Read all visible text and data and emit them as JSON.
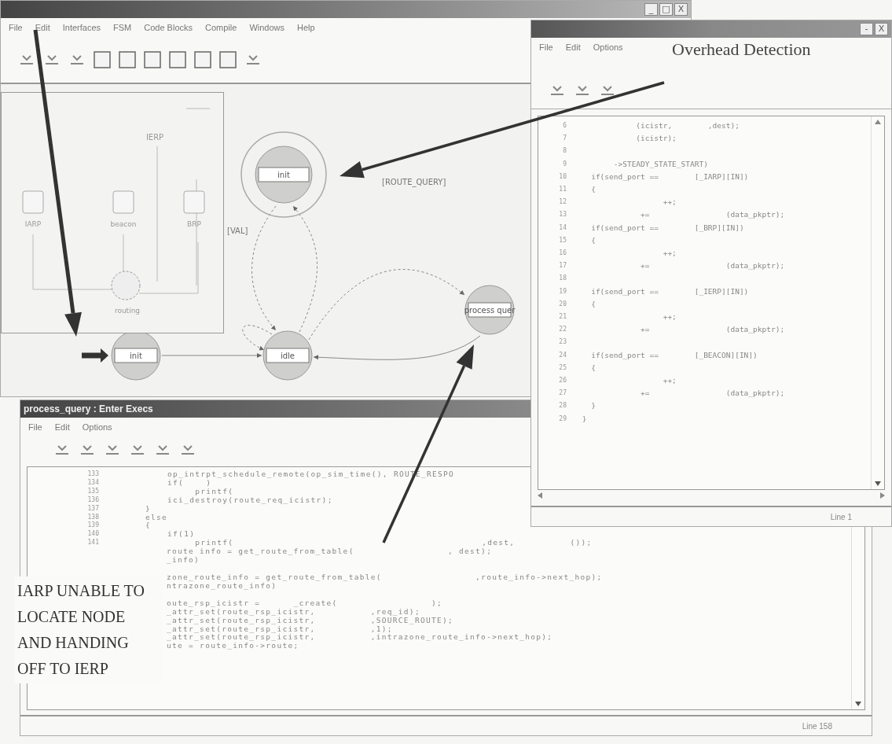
{
  "main_window": {
    "controls": [
      "_",
      "□",
      "X"
    ],
    "menu": [
      "File",
      "Edit",
      "Interfaces",
      "FSM",
      "Code Blocks",
      "Compile",
      "Windows",
      "Help"
    ],
    "inset_diagram": {
      "top_label": "IERP",
      "blocks": [
        "IARP",
        "beacon",
        "BRP"
      ],
      "bottom_label": "routing"
    },
    "fsm": {
      "states": [
        {
          "name": "init",
          "highlighted": true,
          "initial": false
        },
        {
          "name": "idle",
          "highlighted": false,
          "initial": false
        },
        {
          "name": "init",
          "highlighted": false,
          "initial": true
        },
        {
          "name": "process quer",
          "highlighted": false,
          "initial": false
        }
      ],
      "transition_labels": [
        "[VAL]",
        "[ROUTE_QUERY]"
      ]
    }
  },
  "detail_window": {
    "controls": [
      "-",
      "X"
    ],
    "menu": [
      "File",
      "Edit",
      "Options"
    ],
    "lines": [
      {
        "num": "6",
        "text": "             (icistr,        ,dest);"
      },
      {
        "num": "7",
        "text": "             (icistr);"
      },
      {
        "num": "8"
      },
      {
        "num": "9",
        "text": "        ->STEADY_STATE_START)"
      },
      {
        "num": "10",
        "text": "   if(send_port ==        [_IARP][IN])"
      },
      {
        "num": "11",
        "text": "   {"
      },
      {
        "num": "12",
        "text": "                   ++;"
      },
      {
        "num": "13",
        "text": "              +=                 (data_pkptr);"
      },
      {
        "num": "14",
        "text": "   if(send_port ==        [_BRP][IN])"
      },
      {
        "num": "15",
        "text": "   {"
      },
      {
        "num": "16",
        "text": "                   ++;"
      },
      {
        "num": "17",
        "text": "              +=                 (data_pkptr);"
      },
      {
        "num": "18"
      },
      {
        "num": "19",
        "text": "   if(send_port ==        [_IERP][IN])"
      },
      {
        "num": "20",
        "text": "   {"
      },
      {
        "num": "21",
        "text": "                   ++;"
      },
      {
        "num": "22",
        "text": "              +=                 (data_pkptr);"
      },
      {
        "num": "23"
      },
      {
        "num": "24",
        "text": "   if(send_port ==        [_BEACON][IN])"
      },
      {
        "num": "25",
        "text": "   {"
      },
      {
        "num": "26",
        "text": "                   ++;"
      },
      {
        "num": "27",
        "text": "              +=                 (data_pkptr);"
      },
      {
        "num": "28",
        "text": "   }"
      },
      {
        "num": "29",
        "text": " }"
      }
    ],
    "status": "Line 1"
  },
  "code_window": {
    "title": "process_query : Enter Execs",
    "menu": [
      "File",
      "Edit",
      "Options"
    ],
    "line_groups": [
      {
        "lines": [
          {
            "num": "133",
            "text": "    op_intrpt_schedule_remote(op_sim_time(), ROUTE_RESPO"
          },
          {
            "num": "134",
            "text": "    if(    )"
          },
          {
            "num": "135",
            "text": "         printf("
          },
          {
            "num": "136",
            "text": "    ici_destroy(route_req_icistr);"
          },
          {
            "num": "137",
            "text": "}"
          },
          {
            "num": "138",
            "text": "else"
          },
          {
            "num": "139",
            "text": "{"
          },
          {
            "num": "140",
            "text": "    if(1)"
          },
          {
            "num": "141",
            "text": "         printf(                                             ,dest,          ());"
          },
          {
            "text": "route info = get_route_from_table(                 , dest);"
          },
          {
            "text": "_info)"
          }
        ]
      },
      {
        "lines": [
          {
            "text": "zone_route_info = get_route_from_table(                 ,route_info->next_hop);"
          },
          {
            "text": "ntrazone_route_info)"
          }
        ]
      },
      {
        "lines": [
          {
            "text": "oute_rsp_icistr =      _create(                 );"
          },
          {
            "text": "_attr_set(route_rsp_icistr,          ,req_id);"
          },
          {
            "text": "_attr_set(route_rsp_icistr,          ,SOURCE_ROUTE);"
          },
          {
            "text": "_attr_set(route_rsp_icistr,          ,1);"
          },
          {
            "text": "_attr_set(route_rsp_icistr,          ,intrazone_route_info->next_hop);"
          },
          {
            "text": "ute = route_info->route;"
          }
        ]
      }
    ],
    "status": "Line 158"
  },
  "annotations": {
    "overhead": "Overhead Detection",
    "handoff": "IARP UNABLE TO LOCATE NODE AND HANDING OFF TO IERP"
  }
}
